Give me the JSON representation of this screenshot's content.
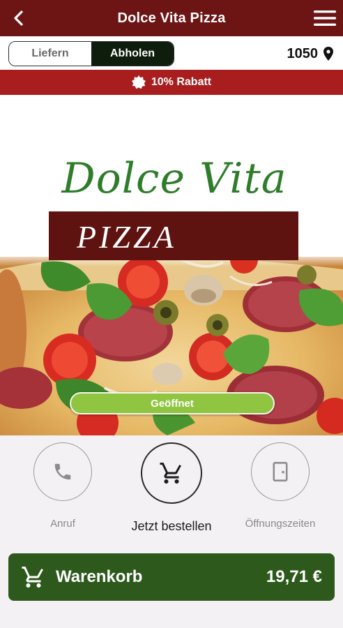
{
  "header": {
    "title": "Dolce Vita Pizza",
    "back_icon": "chevron-left-icon",
    "menu_icon": "hamburger-menu-icon",
    "background": "#6d1515"
  },
  "order_mode": {
    "options": [
      "Liefern",
      "Abholen"
    ],
    "selected": "Abholen"
  },
  "location": {
    "postal_code": "1050",
    "icon": "map-pin-icon"
  },
  "promo": {
    "label": "10% Rabatt",
    "icon": "badge-icon",
    "background": "#a81d1d"
  },
  "hero": {
    "logo_script": "Dolce Vita",
    "logo_word": "PIZZA",
    "status_label": "Geöffnet",
    "status_color": "#8fc540"
  },
  "actions": [
    {
      "label": "Anruf",
      "icon": "phone-icon"
    },
    {
      "label": "Jetzt bestellen",
      "icon": "cart-icon"
    },
    {
      "label": "Öffnungszeiten",
      "icon": "door-icon"
    }
  ],
  "cart": {
    "label": "Warenkorb",
    "total": "19,71 €",
    "icon": "cart-icon",
    "background": "#2d5a1c"
  }
}
